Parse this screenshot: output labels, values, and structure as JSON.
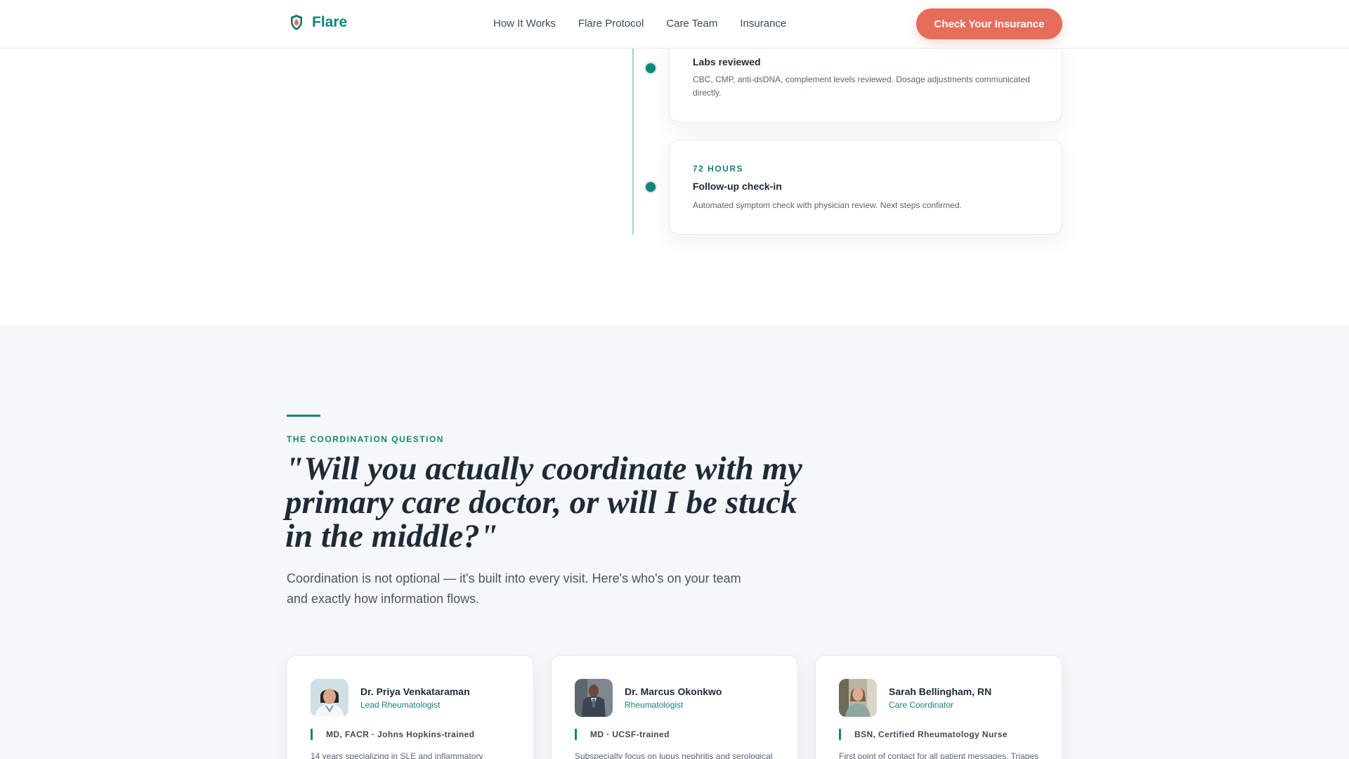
{
  "header": {
    "brand": "Flare",
    "nav": [
      "How It Works",
      "Flare Protocol",
      "Care Team",
      "Insurance"
    ],
    "cta": "Check Your Insurance"
  },
  "timeline": {
    "items": [
      {
        "time": "",
        "title": "Labs reviewed",
        "desc": "CBC, CMP, anti-dsDNA, complement levels reviewed. Dosage adjustments communicated directly."
      },
      {
        "time": "72 HOURS",
        "title": "Follow-up check-in",
        "desc": "Automated symptom check with physician review. Next steps confirmed."
      }
    ]
  },
  "coordination": {
    "eyebrow": "THE COORDINATION QUESTION",
    "quote": "\"Will you actually coordinate with my primary care doctor, or will I be stuck in the middle?\"",
    "lede": "Coordination is not optional — it's built into every visit. Here's who's on your team and exactly how information flows.",
    "team": [
      {
        "name": "Dr. Priya Venkataraman",
        "role": "Lead Rheumatologist",
        "creds": "MD, FACR · Johns Hopkins-trained",
        "bio": "14 years specializing in SLE and inflammatory"
      },
      {
        "name": "Dr. Marcus Okonkwo",
        "role": "Rheumatologist",
        "creds": "MD · UCSF-trained",
        "bio": "Subspecialty focus on lupus nephritis and serological"
      },
      {
        "name": "Sarah Bellingham, RN",
        "role": "Care Coordinator",
        "creds": "BSN, Certified Rheumatology Nurse",
        "bio": "First point of contact for all patient messages. Triages"
      }
    ]
  },
  "colors": {
    "brand": "#13857a",
    "cta": "#e56d5a",
    "text": "#1f2a37",
    "section_bg": "#f5f7f9"
  }
}
